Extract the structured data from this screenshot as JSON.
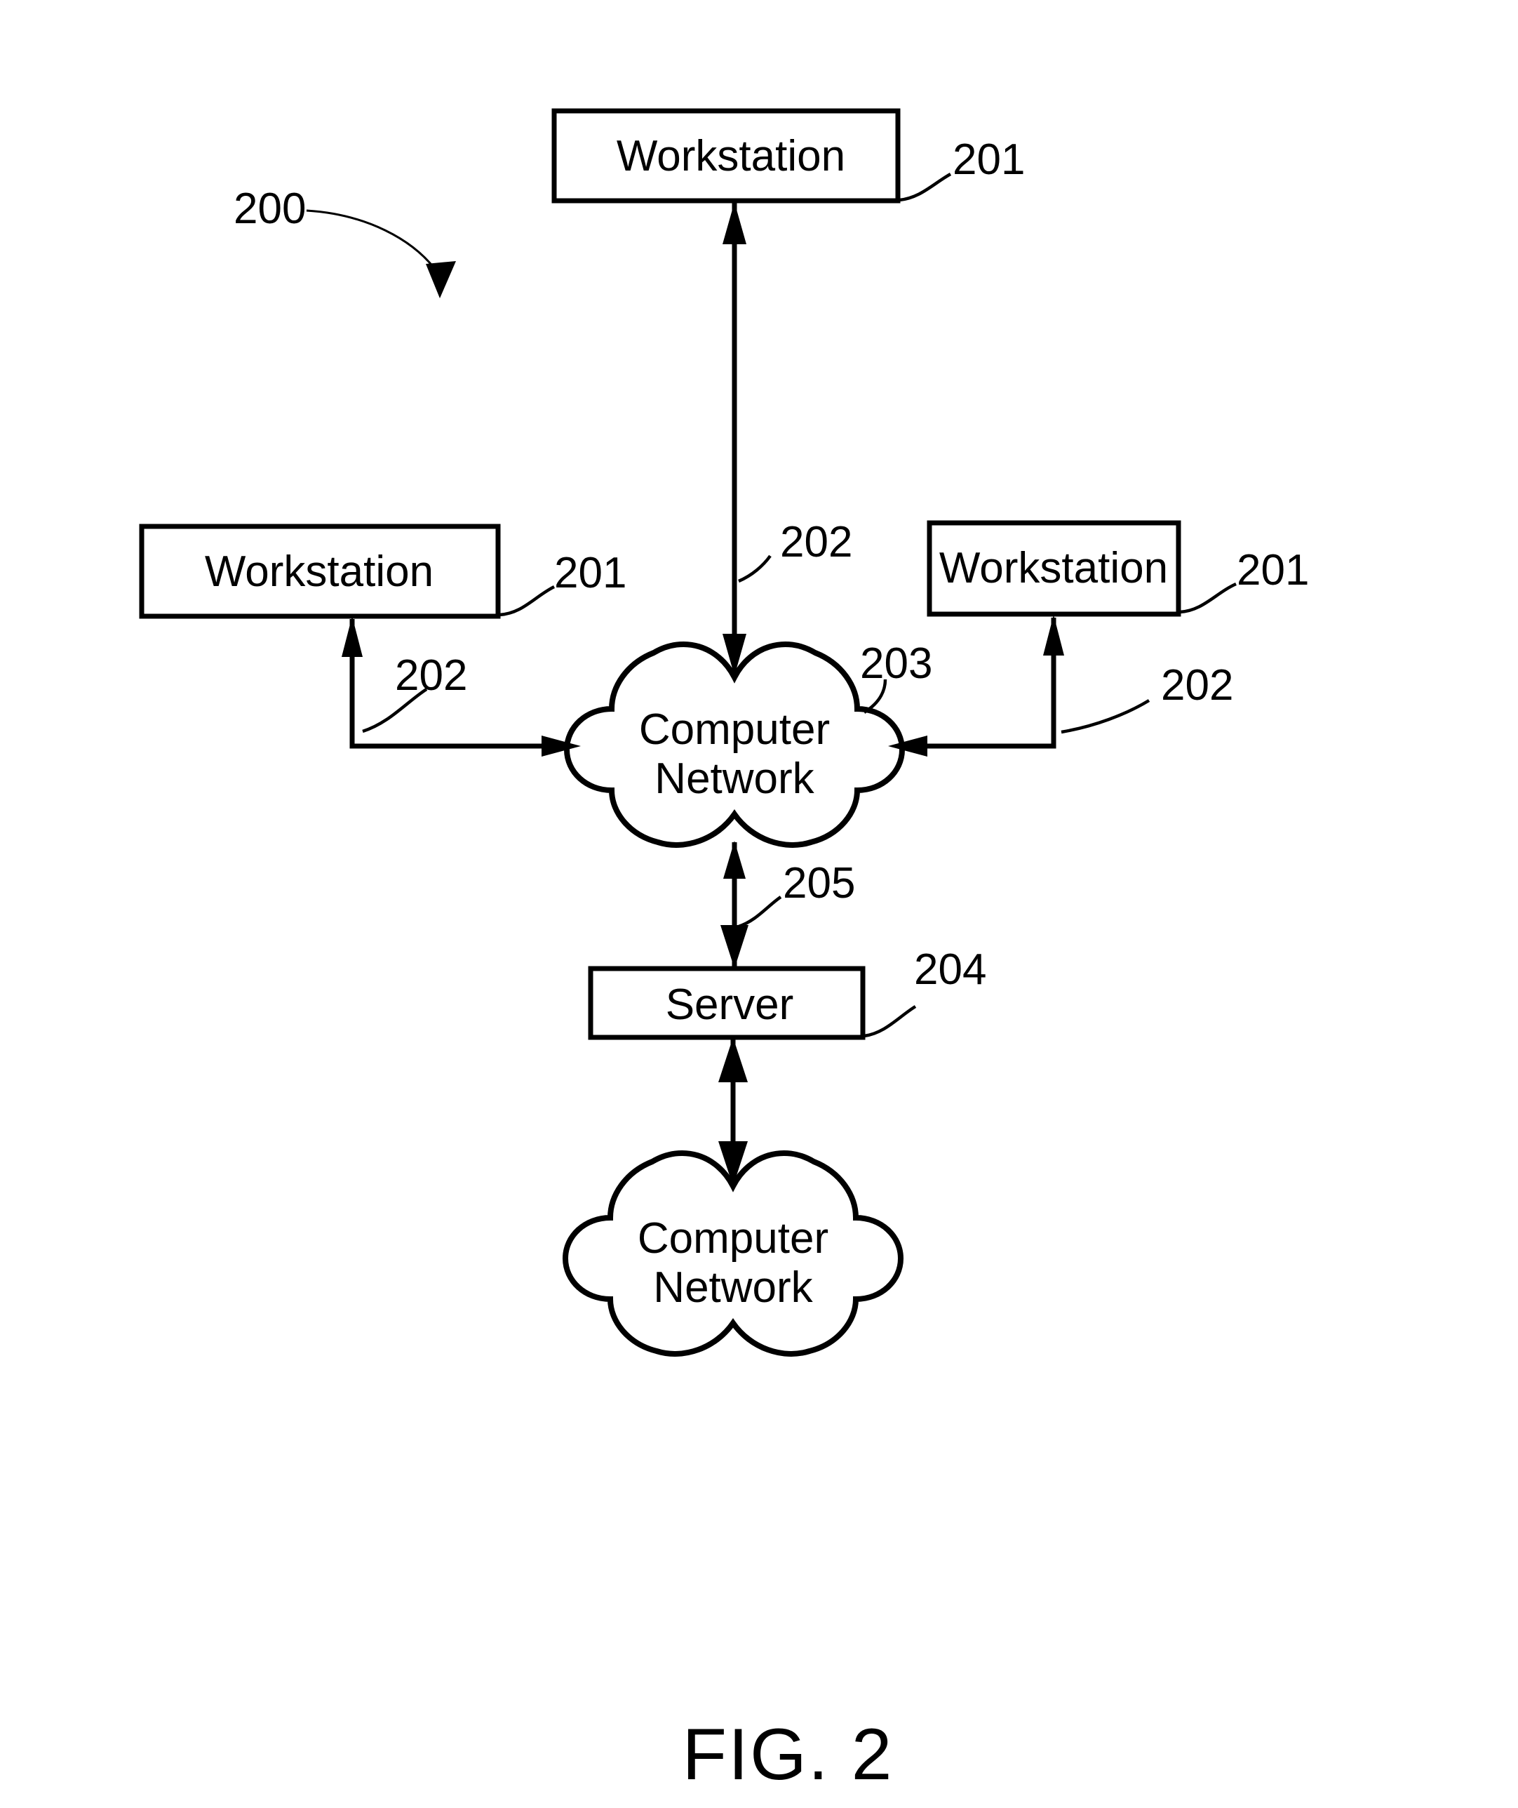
{
  "figure": {
    "caption": "FIG. 2",
    "system_ref": "200"
  },
  "nodes": {
    "workstation_top": {
      "label": "Workstation",
      "ref": "201"
    },
    "workstation_left": {
      "label": "Workstation",
      "ref": "201"
    },
    "workstation_right": {
      "label": "Workstation",
      "ref": "201"
    },
    "network_center": {
      "label_line1": "Computer",
      "label_line2": "Network",
      "ref": "203"
    },
    "server": {
      "label": "Server",
      "ref": "204"
    },
    "network_bottom": {
      "label_line1": "Computer",
      "label_line2": "Network"
    }
  },
  "connections": {
    "top_link_ref": "202",
    "left_link_ref": "202",
    "right_link_ref": "202",
    "server_link_ref": "205"
  },
  "colors": {
    "ink": "#000000",
    "paper": "#ffffff"
  }
}
